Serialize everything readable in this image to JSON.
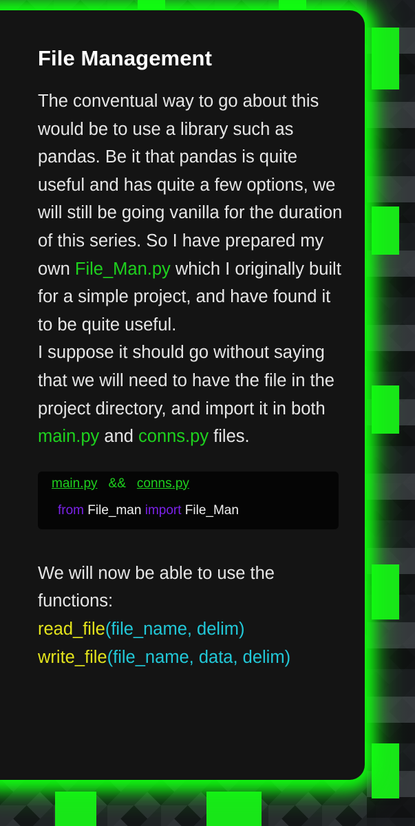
{
  "section": {
    "title": "File Management",
    "paragraph1": {
      "part1": "The conventual way to go about this would be to use a library such as pandas. Be it that pandas is quite useful and has quite a few options, we will still be going vanilla for the duration of this series. So I have prepared my own ",
      "file_link": "File_Man.py",
      "part2": " which I originally built for a simple project, and have found it to be quite useful."
    },
    "paragraph2": {
      "part1": "I suppose it should go without saying that we will need to have the file in the project directory, and import it in both ",
      "main_file": "main.py",
      "part2": " and ",
      "conns_file": "conns.py",
      "part3": " files."
    },
    "code_block": {
      "file1": "main.py",
      "separator": "&&",
      "file2": "conns.py",
      "kw_from": "from",
      "module": "File_man",
      "kw_import": "import",
      "name": "File_Man"
    },
    "paragraph3": "We will now be able to use the functions:",
    "functions": [
      {
        "name": "read_file",
        "args": "(file_name, delim)"
      },
      {
        "name": "write_file",
        "args": "(file_name, data, delim)"
      }
    ]
  },
  "colors": {
    "accent_green": "#1ed11e",
    "glow_green": "#19e619",
    "keyword_purple": "#7b22e8",
    "function_yellow": "#e3e31c",
    "args_cyan": "#22c8d8",
    "card_background": "#141414"
  }
}
